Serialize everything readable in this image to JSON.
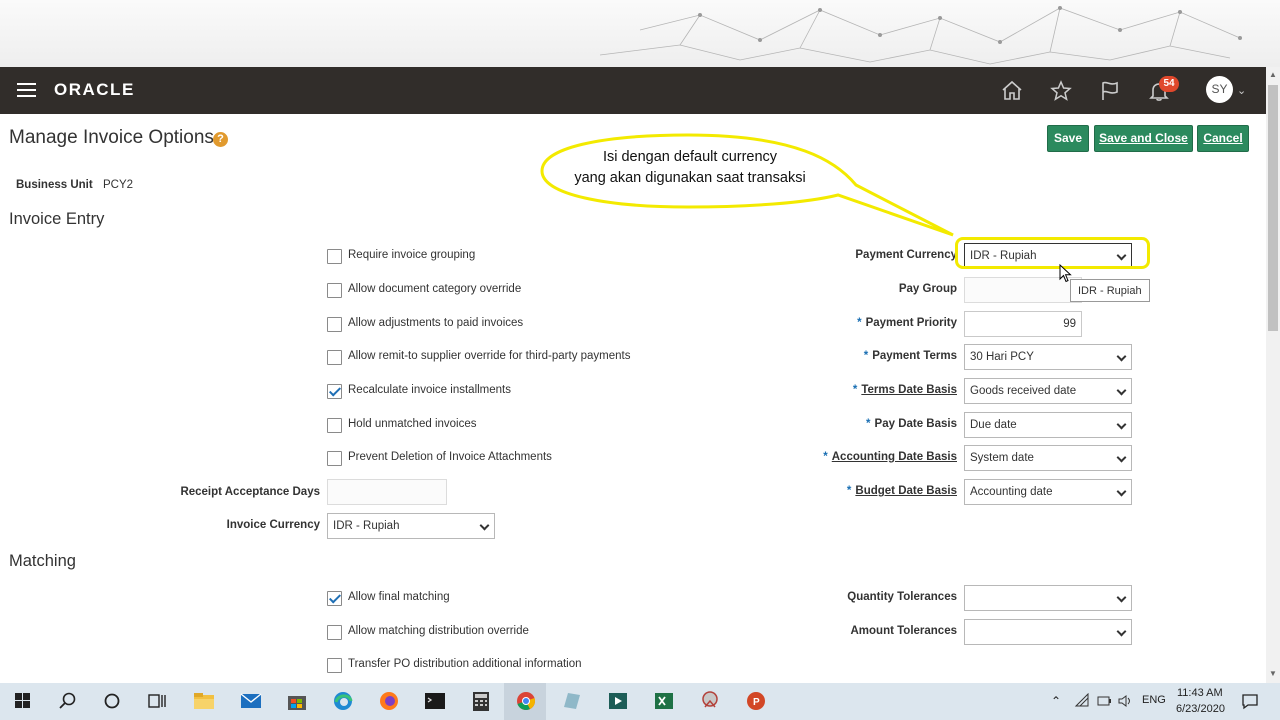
{
  "header": {
    "logo": "ORACLE",
    "notification_count": "54",
    "user_initials": "SY"
  },
  "page": {
    "title": "Manage Invoice Options",
    "help_icon": "?"
  },
  "actions": {
    "save": "Save",
    "save_close": "Save and Close",
    "cancel": "Cancel"
  },
  "business_unit": {
    "label": "Business Unit",
    "value": "PCY2"
  },
  "annotation": {
    "line1": "Isi dengan default currency",
    "line2": "yang akan digunakan saat transaksi"
  },
  "invoice_entry": {
    "title": "Invoice Entry",
    "checkboxes": [
      {
        "label": "Require invoice grouping",
        "checked": false
      },
      {
        "label": "Allow document category override",
        "checked": false
      },
      {
        "label": "Allow adjustments to paid invoices",
        "checked": false
      },
      {
        "label": "Allow remit-to supplier override for third-party payments",
        "checked": false
      },
      {
        "label": "Recalculate invoice installments",
        "checked": true
      },
      {
        "label": "Hold unmatched invoices",
        "checked": false
      },
      {
        "label": "Prevent Deletion of Invoice Attachments",
        "checked": false
      }
    ],
    "receipt_acceptance_days": {
      "label": "Receipt Acceptance Days",
      "value": ""
    },
    "invoice_currency": {
      "label": "Invoice Currency",
      "value": "IDR - Rupiah"
    },
    "right_fields": [
      {
        "label": "Payment Currency",
        "value": "IDR - Rupiah",
        "required": false
      },
      {
        "label": "Pay Group",
        "value": "",
        "required": false
      },
      {
        "label": "Payment Priority",
        "value": "99",
        "required": true
      },
      {
        "label": "Payment Terms",
        "value": "30 Hari PCY",
        "required": true
      },
      {
        "label": "Terms Date Basis",
        "value": "Goods received date",
        "required": true
      },
      {
        "label": "Pay Date Basis",
        "value": "Due date",
        "required": true
      },
      {
        "label": "Accounting Date Basis",
        "value": "System date",
        "required": true
      },
      {
        "label": "Budget Date Basis",
        "value": "Accounting date",
        "required": true
      }
    ],
    "tooltip": "IDR - Rupiah"
  },
  "matching": {
    "title": "Matching",
    "checkboxes": [
      {
        "label": "Allow final matching",
        "checked": true
      },
      {
        "label": "Allow matching distribution override",
        "checked": false
      },
      {
        "label": "Transfer PO distribution additional information",
        "checked": false
      }
    ],
    "right_fields": [
      {
        "label": "Quantity Tolerances",
        "value": ""
      },
      {
        "label": "Amount Tolerances",
        "value": ""
      }
    ]
  },
  "taskbar": {
    "language": "ENG",
    "time": "11:43 AM",
    "date": "6/23/2020"
  },
  "colors": {
    "header_bg": "#312d2a",
    "button_green": "#2b8a5e",
    "annotation_yellow": "#f3ea00",
    "required_star": "#1a6fb3"
  }
}
